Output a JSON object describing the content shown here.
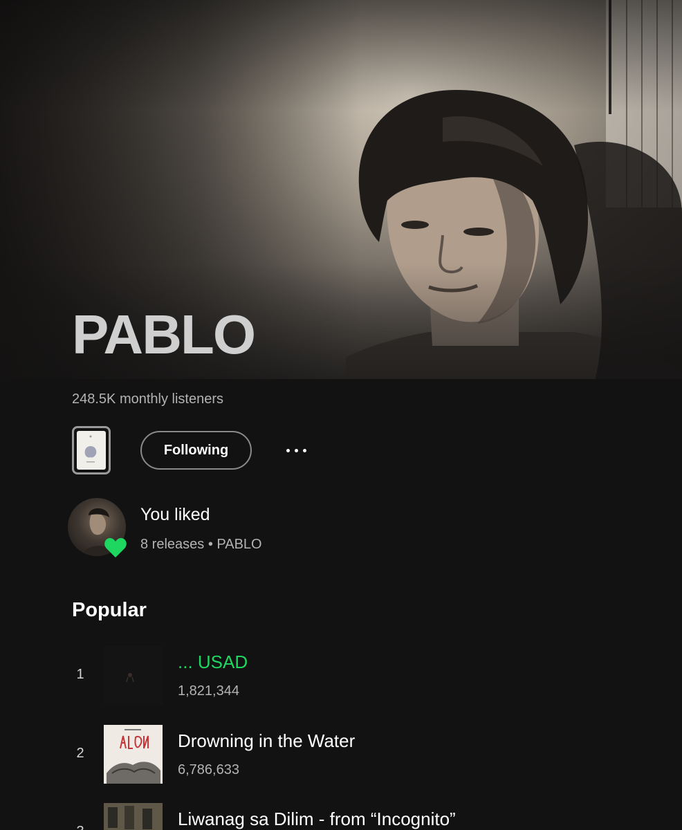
{
  "artist": {
    "name": "PABLO",
    "monthly_listeners": "248.5K monthly listeners"
  },
  "actions": {
    "follow_label": "Following",
    "more_icon": "more-horizontal-icon"
  },
  "liked": {
    "title": "You liked",
    "subtitle": "8 releases • PABLO",
    "badge_icon": "heart-icon",
    "badge_color": "#1ed760"
  },
  "popular": {
    "title": "Popular",
    "tracks": [
      {
        "rank": "1",
        "title": "... USAD",
        "plays": "1,821,344",
        "playing": true
      },
      {
        "rank": "2",
        "title": "Drowning in the Water",
        "plays": "6,786,633",
        "playing": false
      },
      {
        "rank": "3",
        "title": "Liwanag sa Dilim - from “Incognito”",
        "plays": "",
        "playing": false
      }
    ]
  },
  "colors": {
    "background": "#121212",
    "accent": "#1ed760",
    "secondary_text": "#b3b3b3"
  }
}
